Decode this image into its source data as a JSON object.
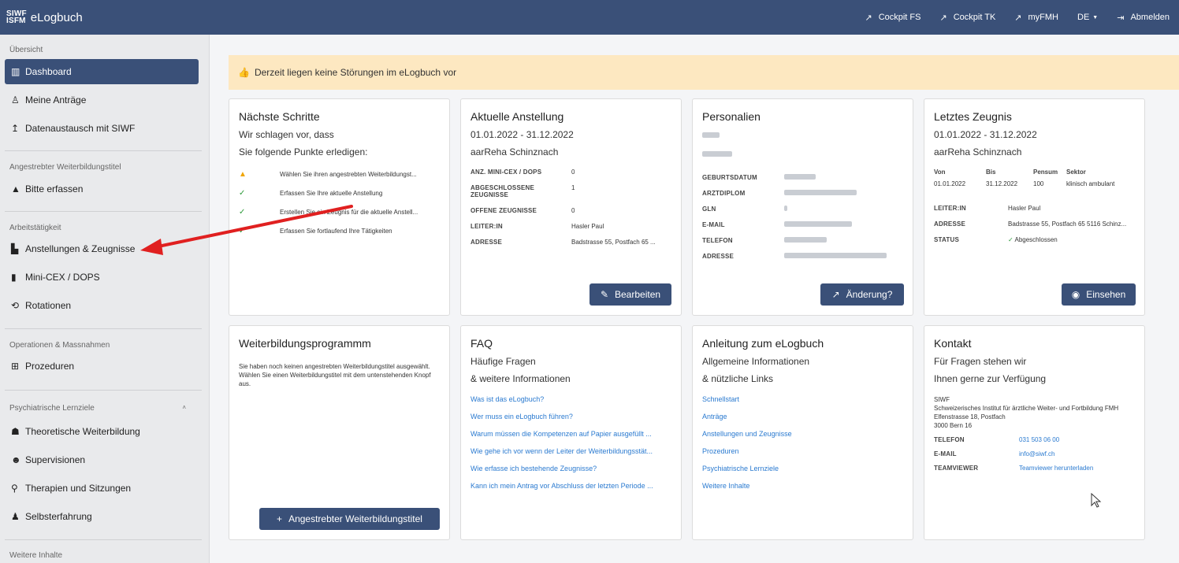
{
  "header": {
    "logo_top": "SIWF",
    "logo_bottom": "ISFM",
    "title": "eLogbuch",
    "nav": [
      {
        "label": "Cockpit FS",
        "icon": "external-arrow-icon"
      },
      {
        "label": "Cockpit TK",
        "icon": "external-arrow-icon"
      },
      {
        "label": "myFMH",
        "icon": "external-arrow-icon"
      },
      {
        "label": "DE",
        "icon": "caret-down-icon"
      },
      {
        "label": "Abmelden",
        "icon": "logout-icon"
      }
    ]
  },
  "sidebar": {
    "sections": [
      "Übersicht",
      "Angestrebter Weiterbildungstitel",
      "Arbeitstätigkeit",
      "Operationen & Massnahmen",
      "Psychiatrische Lernziele",
      "Weitere Inhalte"
    ],
    "items": [
      {
        "label": "Dashboard",
        "icon": "dashboard-icon"
      },
      {
        "label": "Meine Anträge",
        "icon": "stamp-icon"
      },
      {
        "label": "Datenaustausch mit SIWF",
        "icon": "upload-icon"
      },
      {
        "label": "Bitte erfassen",
        "icon": "warning-icon"
      },
      {
        "label": "Anstellungen & Zeugnisse",
        "icon": "building-icon"
      },
      {
        "label": "Mini-CEX / DOPS",
        "icon": "book-icon"
      },
      {
        "label": "Rotationen",
        "icon": "rotate-icon"
      },
      {
        "label": "Prozeduren",
        "icon": "plus-square-icon"
      },
      {
        "label": "Theoretische Weiterbildung",
        "icon": "reader-icon"
      },
      {
        "label": "Supervisionen",
        "icon": "supervision-icon"
      },
      {
        "label": "Therapien und Sitzungen",
        "icon": "location-icon"
      },
      {
        "label": "Selbsterfahrung",
        "icon": "person-icon"
      }
    ]
  },
  "alert": {
    "text": "Derzeit liegen keine Störungen im eLogbuch vor",
    "icon": "thumbs-up-icon"
  },
  "cards": {
    "next_steps": {
      "title": "Nächste Schritte",
      "line1": "Wir schlagen vor, dass",
      "line2": "Sie folgende Punkte erledigen:",
      "steps": [
        {
          "text": "Wählen Sie ihren angestrebten Weiterbildungst...",
          "status": "warning"
        },
        {
          "text": "Erfassen Sie Ihre aktuelle Anstellung",
          "status": "done"
        },
        {
          "text": "Erstellen Sie ein Zeugnis für die aktuelle Anstell...",
          "status": "done"
        },
        {
          "text": "Erfassen Sie fortlaufend Ihre Tätigkeiten",
          "status": "done"
        }
      ]
    },
    "employment": {
      "title": "Aktuelle Anstellung",
      "dates": "01.01.2022 - 31.12.2022",
      "place": "aarReha Schinznach",
      "rows": [
        {
          "k": "Anz. Mini-CEX / DOPS",
          "v": "0"
        },
        {
          "k": "Abgeschlossene Zeugnisse",
          "v": "1"
        },
        {
          "k": "Offene Zeugnisse",
          "v": "0"
        },
        {
          "k": "Leiter:in",
          "v": "Hasler Paul"
        },
        {
          "k": "Adresse",
          "v": "Badstrasse 55, Postfach 65 ..."
        }
      ],
      "button": "Bearbeiten"
    },
    "personal": {
      "title": "Personalien",
      "rows": [
        "Geburtsdatum",
        "Arztdiplom",
        "GLN",
        "E-Mail",
        "Telefon",
        "Adresse"
      ],
      "button": "Änderung?"
    },
    "certificate": {
      "title": "Letztes Zeugnis",
      "dates": "01.01.2022 - 31.12.2022",
      "place": "aarReha Schinznach",
      "headers": [
        "Von",
        "Bis",
        "Pensum",
        "Sektor"
      ],
      "values": [
        "01.01.2022",
        "31.12.2022",
        "100",
        "klinisch ambulant"
      ],
      "rows": [
        {
          "k": "Leiter:in",
          "v": "Hasler Paul"
        },
        {
          "k": "Adresse",
          "v": "Badstrasse 55, Postfach 65 5116 Schinz..."
        },
        {
          "k": "Status",
          "v": "Abgeschlossen"
        }
      ],
      "button": "Einsehen"
    },
    "program": {
      "title": "Weiterbildungsprogrammm",
      "text": "Sie haben noch keinen angestrebten Weiterbildungstitel ausgewählt. Wählen Sie einen Weiterbildungstitel mit dem untenstehenden Knopf aus.",
      "button": "Angestrebter Weiterbildungstitel"
    },
    "faq": {
      "title": "FAQ",
      "line1": "Häufige Fragen",
      "line2": "& weitere Informationen",
      "links": [
        "Was ist das eLogbuch?",
        "Wer muss ein eLogbuch führen?",
        "Warum müssen die Kompetenzen auf Papier ausgefüllt ...",
        "Wie gehe ich vor wenn der Leiter der Weiterbildungsstät...",
        "Wie erfasse ich bestehende Zeugnisse?",
        "Kann ich mein Antrag vor Abschluss der letzten Periode ..."
      ]
    },
    "guide": {
      "title": "Anleitung zum eLogbuch",
      "line1": "Allgemeine Informationen",
      "line2": "& nützliche Links",
      "links": [
        "Schnellstart",
        "Anträge",
        "Anstellungen und Zeugnisse",
        "Prozeduren",
        "Psychiatrische Lernziele",
        "Weitere Inhalte"
      ]
    },
    "contact": {
      "title": "Kontakt",
      "line1": "Für Fragen stehen wir",
      "line2": "Ihnen gerne zur Verfügung",
      "org": "SIWF",
      "org_full": "Schweizerisches Institut für ärztliche Weiter- und Fortbildung FMH",
      "street": "Elfenstrasse 18, Postfach",
      "city": "3000 Bern 16",
      "rows": [
        {
          "k": "Telefon",
          "v": "031 503 06 00"
        },
        {
          "k": "E-Mail",
          "v": "info@siwf.ch"
        },
        {
          "k": "Teamviewer",
          "v": "Teamviewer herunterladen"
        }
      ]
    }
  },
  "colors": {
    "primary": "#3a5078",
    "alert": "#fde8c1",
    "link": "#2a7ad0",
    "arrow": "#e02020"
  }
}
